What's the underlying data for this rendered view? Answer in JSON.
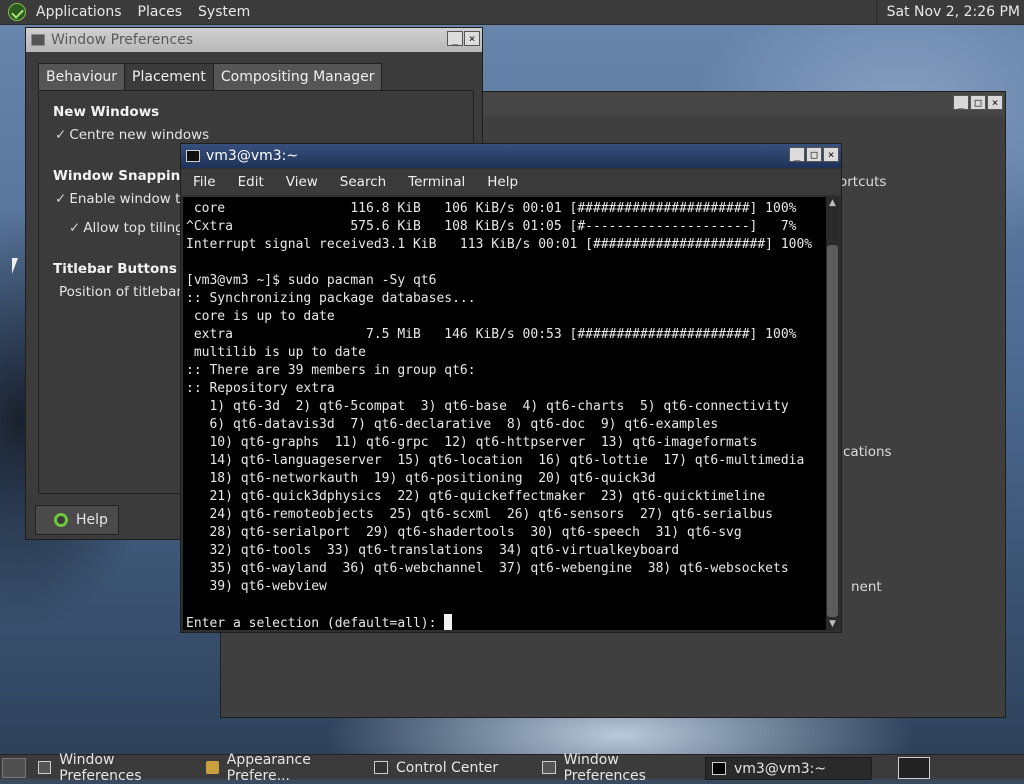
{
  "top_panel": {
    "menu": [
      "Applications",
      "Places",
      "System"
    ],
    "clock": "Sat Nov 2, 2:26 PM"
  },
  "window_prefs": {
    "title": "Window Preferences",
    "tabs": [
      "Behaviour",
      "Placement",
      "Compositing Manager"
    ],
    "active_tab": "Placement",
    "new_windows_heading": "New Windows",
    "centre_new_windows": "Centre new windows",
    "snapping_heading": "Window Snapping",
    "enable_window_tiling": "Enable window tili",
    "allow_top_tiling": "Allow top tiling",
    "titlebar_buttons_heading": "Titlebar Buttons",
    "position_of_titlebar": "Position of titlebar b",
    "help_label": "Help"
  },
  "control_center": {
    "partial_1": "ortcuts",
    "partial_2": "cations",
    "partial_3": "nent"
  },
  "terminal": {
    "title": "vm3@vm3:~",
    "menu": [
      "File",
      "Edit",
      "View",
      "Search",
      "Terminal",
      "Help"
    ],
    "lines": [
      " core                116.8 KiB   106 KiB/s 00:01 [######################] 100%",
      "^Cxtra               575.6 KiB   108 KiB/s 01:05 [#---------------------]   7%",
      "Interrupt signal received3.1 KiB   113 KiB/s 00:01 [######################] 100%",
      "",
      "[vm3@vm3 ~]$ sudo pacman -Sy qt6",
      ":: Synchronizing package databases...",
      " core is up to date",
      " extra                 7.5 MiB   146 KiB/s 00:53 [######################] 100%",
      " multilib is up to date",
      ":: There are 39 members in group qt6:",
      ":: Repository extra",
      "   1) qt6-3d  2) qt6-5compat  3) qt6-base  4) qt6-charts  5) qt6-connectivity",
      "   6) qt6-datavis3d  7) qt6-declarative  8) qt6-doc  9) qt6-examples",
      "   10) qt6-graphs  11) qt6-grpc  12) qt6-httpserver  13) qt6-imageformats",
      "   14) qt6-languageserver  15) qt6-location  16) qt6-lottie  17) qt6-multimedia",
      "   18) qt6-networkauth  19) qt6-positioning  20) qt6-quick3d",
      "   21) qt6-quick3dphysics  22) qt6-quickeffectmaker  23) qt6-quicktimeline",
      "   24) qt6-remoteobjects  25) qt6-scxml  26) qt6-sensors  27) qt6-serialbus",
      "   28) qt6-serialport  29) qt6-shadertools  30) qt6-speech  31) qt6-svg",
      "   32) qt6-tools  33) qt6-translations  34) qt6-virtualkeyboard",
      "   35) qt6-wayland  36) qt6-webchannel  37) qt6-webengine  38) qt6-websockets",
      "   39) qt6-webview",
      ""
    ],
    "prompt": "Enter a selection (default=all): "
  },
  "taskbar": {
    "items": [
      {
        "label": "Window Preferences",
        "icon": "window-icon"
      },
      {
        "label": "Appearance Prefere...",
        "icon": "appearance-icon"
      },
      {
        "label": "Control Center",
        "icon": "control-center-icon"
      },
      {
        "label": "Window Preferences",
        "icon": "window-icon"
      },
      {
        "label": "vm3@vm3:~",
        "icon": "terminal-icon"
      }
    ]
  }
}
